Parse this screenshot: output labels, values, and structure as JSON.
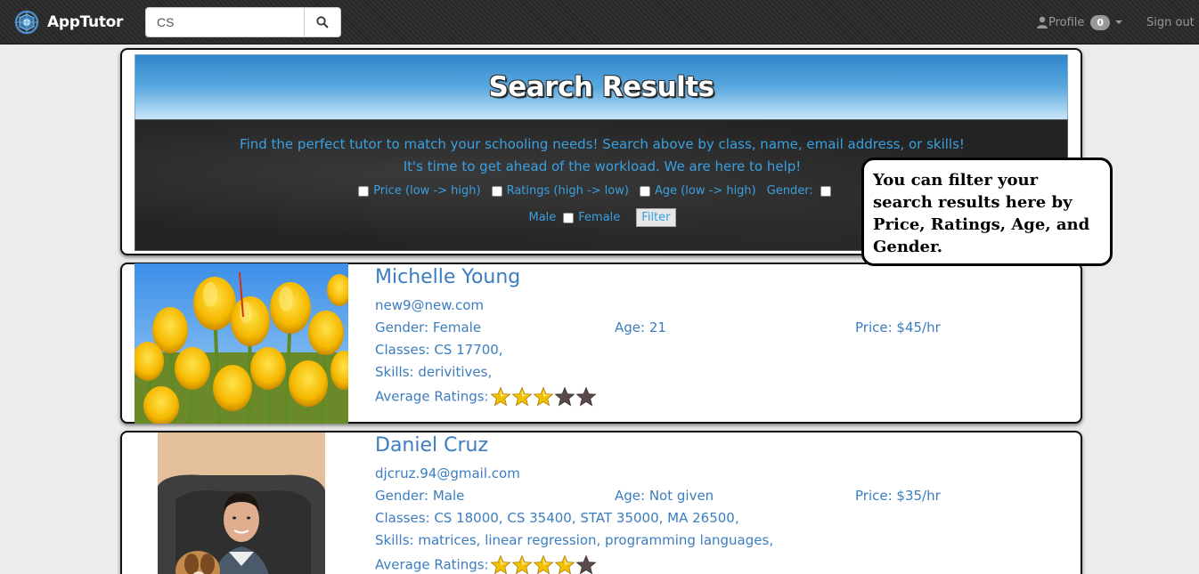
{
  "navbar": {
    "brand": "AppTutor",
    "search_value": "CS",
    "profile_label": "Profile",
    "notification_count": "0",
    "signout_label": "Sign out"
  },
  "header": {
    "title": "Search Results",
    "line1": "Find the perfect tutor to match your schooling needs! Search above by class, name, email address, or skills!",
    "line2": "It's time to get ahead of the workload. We are here to help!",
    "filters": {
      "price": "Price (low -> high)",
      "ratings": "Ratings (high -> low)",
      "age": "Age (low -> high)",
      "gender": "Gender:",
      "male": "Male",
      "female": "Female",
      "button": "Filter"
    }
  },
  "callout": {
    "text": "You can filter your search results here by Price, Ratings, Age, and Gender."
  },
  "results": [
    {
      "name": "Michelle Young",
      "email": "new9@new.com",
      "gender": "Gender: Female",
      "age": "Age: 21",
      "price": "Price: $45/hr",
      "classes": "Classes: CS 17700,",
      "skills": "Skills: derivitives,",
      "ratings_label": "Average Ratings:",
      "rating": 3,
      "rating_max": 5
    },
    {
      "name": "Daniel Cruz",
      "email": "djcruz.94@gmail.com",
      "gender": "Gender: Male",
      "age": "Age: Not given",
      "price": "Price: $35/hr",
      "classes": "Classes: CS 18000, CS 35400, STAT 35000, MA 26500,",
      "skills": "Skills: matrices, linear regression, programming languages,",
      "ratings_label": "Average Ratings:",
      "rating": 4,
      "rating_max": 5
    }
  ],
  "colors": {
    "link_blue": "#3b7dbf",
    "banner_text": "#3aa0e0",
    "navbar_bg": "#2a2a2a",
    "star_filled": "#f2c200",
    "star_empty": "#5a4a4a"
  }
}
